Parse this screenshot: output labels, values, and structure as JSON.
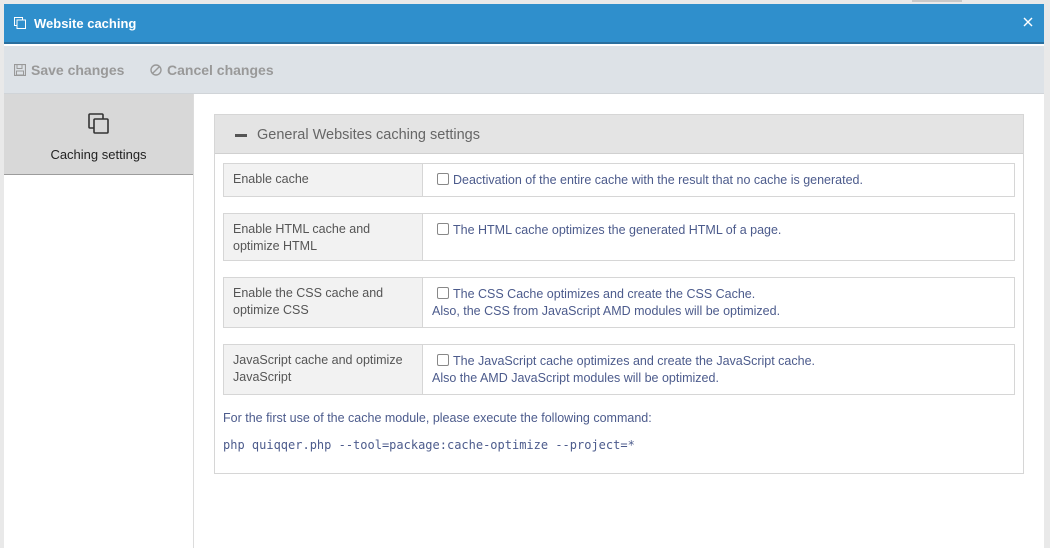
{
  "window": {
    "title": "Website caching",
    "icons": {
      "title": "copy-icon",
      "close": "close-icon"
    }
  },
  "toolbar": {
    "save_label": "Save changes",
    "cancel_label": "Cancel changes",
    "icons": {
      "save": "floppy-disk-icon",
      "cancel": "cancel-circle-icon"
    }
  },
  "sidebar": {
    "items": [
      {
        "label": "Caching settings",
        "icon": "copy-icon",
        "active": true
      }
    ]
  },
  "panel": {
    "title": "General Websites caching settings",
    "rows": [
      {
        "label": "Enable cache",
        "description": "Deactivation of the entire cache with the result that no cache is generated.",
        "description2": "",
        "checked": false
      },
      {
        "label": "Enable HTML cache and optimize HTML",
        "description": "The HTML cache optimizes the generated HTML of a page.",
        "description2": "",
        "checked": false
      },
      {
        "label": "Enable the CSS cache and optimize CSS",
        "description": "The CSS Cache optimizes and create the CSS Cache.",
        "description2": "Also, the CSS from JavaScript AMD modules will be optimized.",
        "checked": false
      },
      {
        "label": "JavaScript cache and optimize JavaScript",
        "description": "The JavaScript cache optimizes and create the JavaScript cache.",
        "description2": "Also the AMD JavaScript modules will be optimized.",
        "checked": false
      }
    ],
    "note": "For the first use of the cache module, please execute the following command:",
    "command": "php quiqqer.php --tool=package:cache-optimize --project=*"
  },
  "colors": {
    "titlebar": "#2f8fcc",
    "toolbar": "#dde2e7",
    "sidebar_active": "#d8d8d8",
    "panel_header": "#e4e4e4",
    "link_text": "#4c5b8c"
  }
}
